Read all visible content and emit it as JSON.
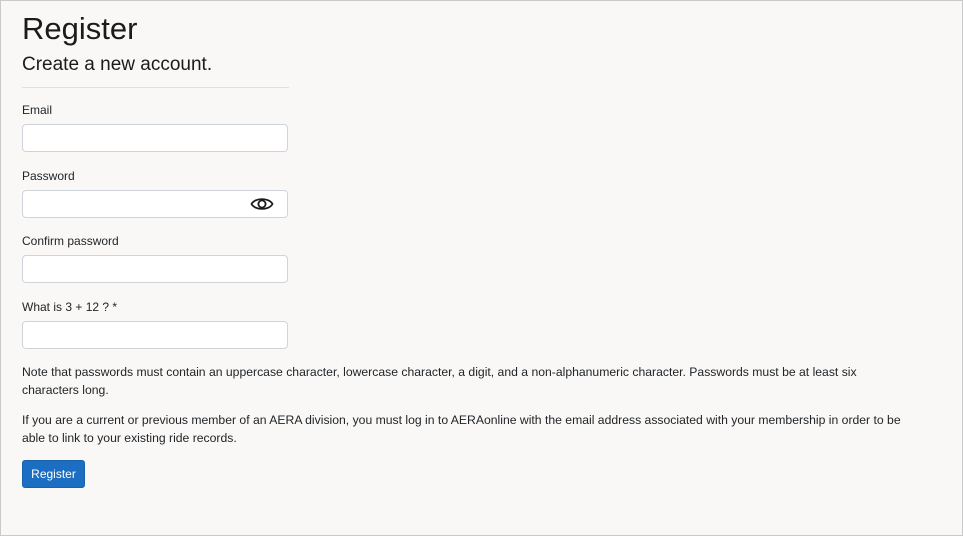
{
  "page": {
    "title": "Register",
    "subtitle": "Create a new account."
  },
  "form": {
    "email": {
      "label": "Email",
      "value": "",
      "placeholder": ""
    },
    "password": {
      "label": "Password",
      "value": "",
      "placeholder": "",
      "toggle_icon": "eye-icon"
    },
    "confirm_password": {
      "label": "Confirm password",
      "value": "",
      "placeholder": ""
    },
    "captcha": {
      "label": "What is 3 + 12 ? *",
      "value": "",
      "placeholder": ""
    }
  },
  "notes": {
    "password_rules": "Note that passwords must contain an uppercase character, lowercase character, a digit, and a non-alphanumeric character. Passwords must be at least six characters long.",
    "aera_members": "If you are a current or previous member of an AERA division, you must log in to AERAonline with the email address associated with your membership in order to be able to link to your existing ride records."
  },
  "actions": {
    "register_label": "Register"
  },
  "colors": {
    "background": "#f9f8f6",
    "primary_button": "#1b6ec2",
    "input_border": "#ced4da"
  }
}
